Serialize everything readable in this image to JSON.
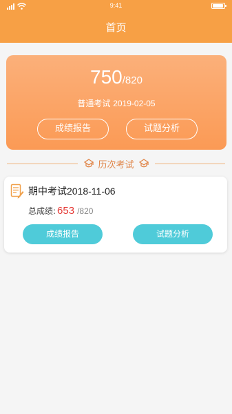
{
  "status_bar": {
    "time": "9:41"
  },
  "nav": {
    "title": "首页"
  },
  "latest_exam": {
    "score": "750",
    "total": "/820",
    "exam_name": "普通考试",
    "date": "2019-02-05",
    "report_button": "成绩报告",
    "analysis_button": "试题分析"
  },
  "history_section": {
    "title": "历次考试"
  },
  "history": [
    {
      "name": "期中考试",
      "date": "2018-11-06",
      "score_label": "总成绩:",
      "score": "653",
      "total": "/820",
      "report_button": "成绩报告",
      "analysis_button": "试题分析"
    }
  ],
  "colors": {
    "header": "#f7a045",
    "hero_gradient_top": "#fbb07a",
    "hero_gradient_bottom": "#fb9a55",
    "teal_button": "#4fcbd9",
    "score_red": "#e53935"
  }
}
